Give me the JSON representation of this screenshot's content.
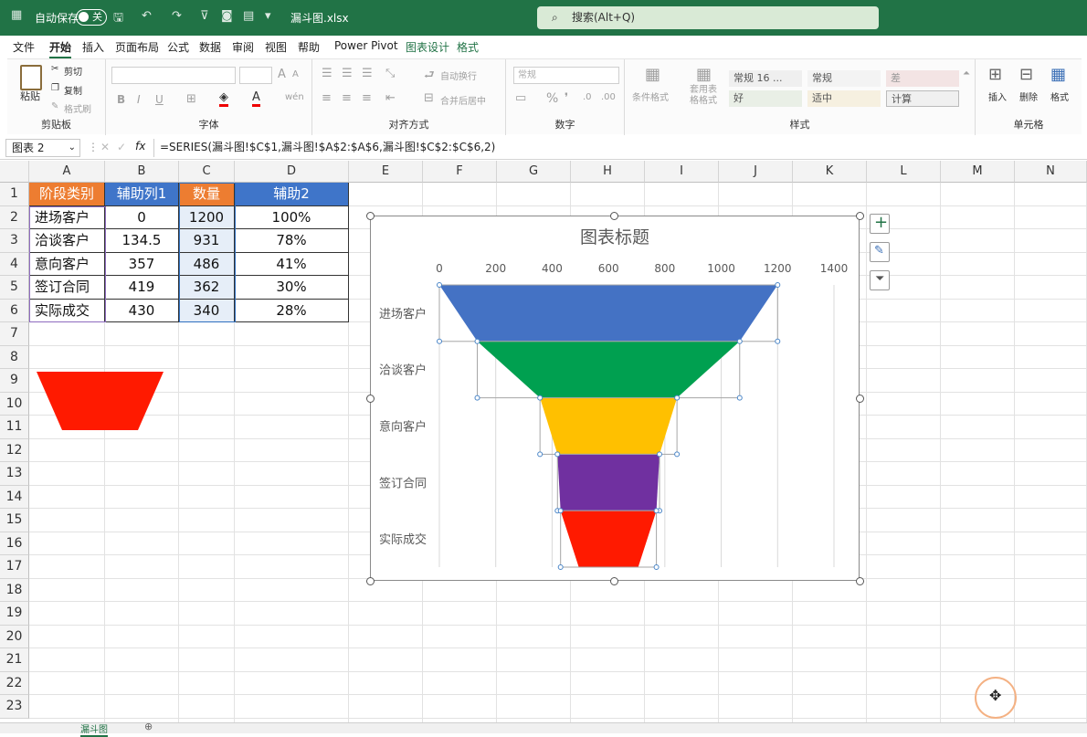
{
  "titlebar": {
    "autosave_label": "自动保存",
    "autosave_state": "关",
    "filename": "漏斗图.xlsx",
    "search_placeholder": "搜索(Alt+Q)"
  },
  "menu": [
    {
      "label": "文件",
      "active": false,
      "green": false
    },
    {
      "label": "开始",
      "active": true,
      "green": false
    },
    {
      "label": "插入",
      "active": false,
      "green": false
    },
    {
      "label": "页面布局",
      "active": false,
      "green": false
    },
    {
      "label": "公式",
      "active": false,
      "green": false
    },
    {
      "label": "数据",
      "active": false,
      "green": false
    },
    {
      "label": "审阅",
      "active": false,
      "green": false
    },
    {
      "label": "视图",
      "active": false,
      "green": false
    },
    {
      "label": "帮助",
      "active": false,
      "green": false
    },
    {
      "label": "Power Pivot",
      "active": false,
      "green": false
    },
    {
      "label": "图表设计",
      "active": false,
      "green": true
    },
    {
      "label": "格式",
      "active": false,
      "green": true
    }
  ],
  "ribbon": {
    "clipboard": {
      "group": "剪贴板",
      "paste": "粘贴",
      "cut": "剪切",
      "copy": "复制",
      "format_painter": "格式刷"
    },
    "font": {
      "group": "字体",
      "bold": "B",
      "italic": "I",
      "underline": "U",
      "size_up": "A",
      "size_down": "A"
    },
    "alignment": {
      "group": "对齐方式",
      "wrap": "自动换行",
      "merge": "合并后居中"
    },
    "number": {
      "group": "数字",
      "format": "常规"
    },
    "styles": {
      "group": "样式",
      "cond_format": "条件格式",
      "table_format": "套用表格格式",
      "cells": [
        "常规 16 ...",
        "常规",
        "差",
        "好",
        "适中",
        "计算"
      ]
    },
    "cells": {
      "group": "单元格",
      "insert": "插入",
      "delete": "删除",
      "format": "格式"
    }
  },
  "formula_bar": {
    "name_box": "图表 2",
    "fx": "fx",
    "formula": "=SERIES(漏斗图!$C$1,漏斗图!$A$2:$A$6,漏斗图!$C$2:$C$6,2)"
  },
  "columns": [
    "A",
    "B",
    "C",
    "D",
    "E",
    "F",
    "G",
    "H",
    "I",
    "J",
    "K",
    "L",
    "M",
    "N"
  ],
  "rows": [
    "1",
    "2",
    "3",
    "4",
    "5",
    "6",
    "7",
    "8",
    "9",
    "10",
    "11",
    "12",
    "13",
    "14",
    "15",
    "16",
    "17",
    "18",
    "19",
    "20",
    "21",
    "22",
    "23"
  ],
  "table": {
    "headers": [
      "阶段类别",
      "辅助列1",
      "数量",
      "辅助2"
    ],
    "rows": [
      [
        "进场客户",
        "0",
        "1200",
        "100%"
      ],
      [
        "洽谈客户",
        "134.5",
        "931",
        "78%"
      ],
      [
        "意向客户",
        "357",
        "486",
        "41%"
      ],
      [
        "签订合同",
        "419",
        "362",
        "30%"
      ],
      [
        "实际成交",
        "430",
        "340",
        "28%"
      ]
    ]
  },
  "shape_color": "#ff1a00",
  "chart_data": {
    "type": "bar",
    "subtype": "stacked-bar-funnel",
    "title": "图表标题",
    "categories": [
      "进场客户",
      "洽谈客户",
      "意向客户",
      "签订合同",
      "实际成交"
    ],
    "series": [
      {
        "name": "辅助列1",
        "values": [
          0,
          134.5,
          357,
          419,
          430
        ],
        "hidden": true
      },
      {
        "name": "数量",
        "values": [
          1200,
          931,
          486,
          362,
          340
        ]
      }
    ],
    "xlim": [
      0,
      1400
    ],
    "xticks": [
      "0",
      "200",
      "400",
      "600",
      "800",
      "1000",
      "1200",
      "1400"
    ],
    "colors": [
      "#4472c4",
      "#00a050",
      "#ffc000",
      "#7030a0",
      "#ff1a00"
    ],
    "grid": true
  },
  "sheet_tab": "漏斗图",
  "colors": {
    "accent": "#217346",
    "header_blue": "#3f75c9",
    "header_orange": "#ed7d31"
  }
}
